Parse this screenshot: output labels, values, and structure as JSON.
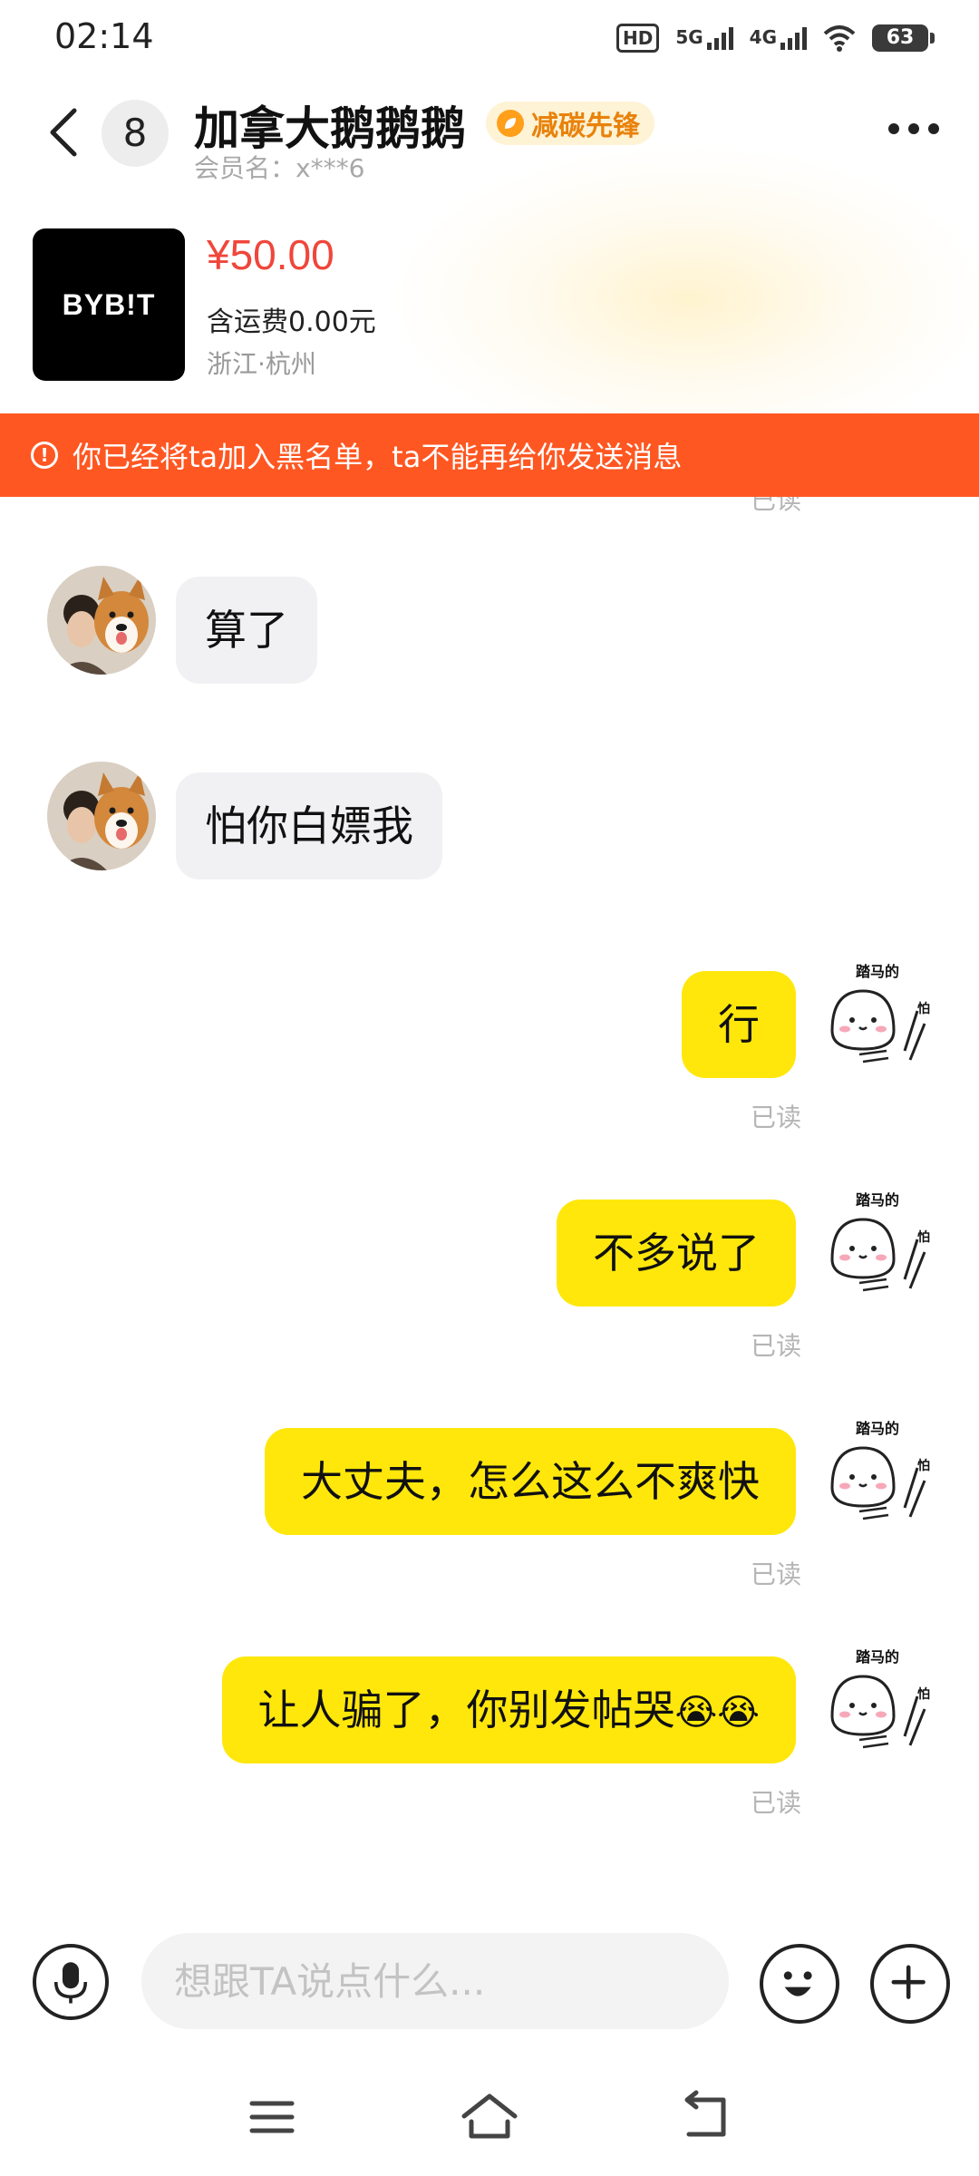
{
  "status_bar": {
    "time": "02:14",
    "hd_label": "HD",
    "net1": "5G",
    "net2": "4G",
    "battery": "63"
  },
  "header": {
    "unread_count": "8",
    "title": "加拿大鹅鹅鹅",
    "badge": "减碳先锋",
    "member_name": "会员名：x***6"
  },
  "product": {
    "logo": "BYB!T",
    "price": "¥50.00",
    "shipping": "含运费0.00元",
    "location": "浙江·杭州"
  },
  "alert": {
    "text": "你已经将ta加入黑名单，ta不能再给你发送消息"
  },
  "chat": {
    "clipped_read": "已读",
    "incoming": [
      {
        "text": "算了"
      },
      {
        "text": "怕你白嫖我"
      }
    ],
    "outgoing": [
      {
        "text": "行",
        "status": "已读"
      },
      {
        "text": "不多说了",
        "status": "已读"
      },
      {
        "text": "大丈夫，怎么这么不爽快",
        "status": "已读"
      },
      {
        "text": "让人骗了，你别发帖哭",
        "emoji": "😭😭",
        "status": "已读"
      }
    ],
    "sticker_caption_top": "踏马的",
    "sticker_caption_side": "怕"
  },
  "input": {
    "placeholder": "想跟TA说点什么..."
  },
  "colors": {
    "accent_yellow": "#ffe70b",
    "alert_red": "#ff5722",
    "price_red": "#f0463b"
  }
}
